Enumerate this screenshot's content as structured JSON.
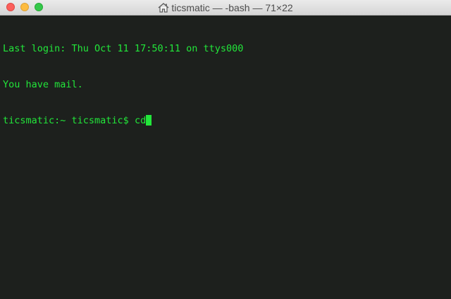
{
  "window": {
    "title": "ticsmatic — -bash — 71×22",
    "title_icon": "home-icon"
  },
  "terminal": {
    "lines": [
      "Last login: Thu Oct 11 17:50:11 on ttys000",
      "You have mail."
    ],
    "prompt": "ticsmatic:~ ticsmatic$ ",
    "input": "cd"
  },
  "colors": {
    "text": "#22e63a",
    "background": "#1d201d",
    "close": "#fc605c",
    "minimize": "#fdbc40",
    "maximize": "#34c84a"
  }
}
